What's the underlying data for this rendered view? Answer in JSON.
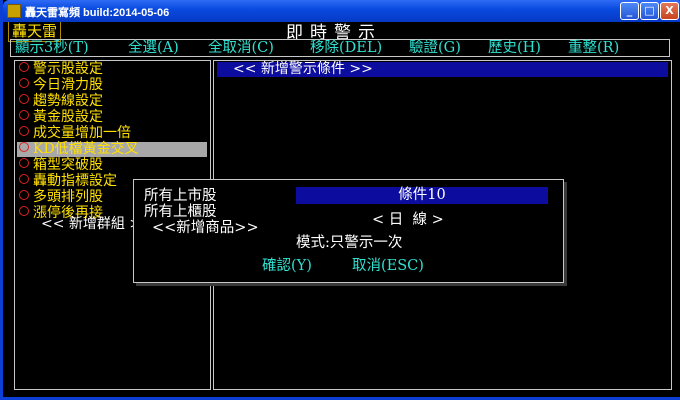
{
  "window": {
    "title": "轟天雷寫頻 build:2014-05-06",
    "controls": {
      "minimize": "_",
      "maximize": "□",
      "close": "X"
    }
  },
  "app": {
    "logo": "轟天雷",
    "title": "即時警示"
  },
  "menu": [
    "顯示3秒(T)",
    "全選(A)",
    "全取消(C)",
    "移除(DEL)",
    "驗證(G)",
    "歷史(H)",
    "重整(R)"
  ],
  "left_list": {
    "items": [
      "警示股設定",
      "今日滑力股",
      "趨勢線設定",
      "黃金股設定",
      "成交量增加一倍",
      "KD低檔黃金交叉",
      "箱型突破股",
      "轟動指標設定",
      "多頭排列股",
      "漲停後再接"
    ],
    "selected_index": 5,
    "add_group": "<< 新增群組 >>"
  },
  "right_panel": {
    "header": "<< 新增警示條件 >>"
  },
  "dialog": {
    "line1": "所有上市股",
    "line2": "所有上櫃股",
    "line3": "<<新增商品>>",
    "condition": "條件10",
    "period": "< 日  線 >",
    "mode": "模式:只警示一次",
    "ok": "確認(Y)",
    "cancel": "取消(ESC)"
  },
  "colors": {
    "menu_text": "#30e0d0",
    "list_text": "#ffe000",
    "radio": "#e02020",
    "highlight": "#0c0c9e",
    "selection": "#a8a8a8"
  }
}
